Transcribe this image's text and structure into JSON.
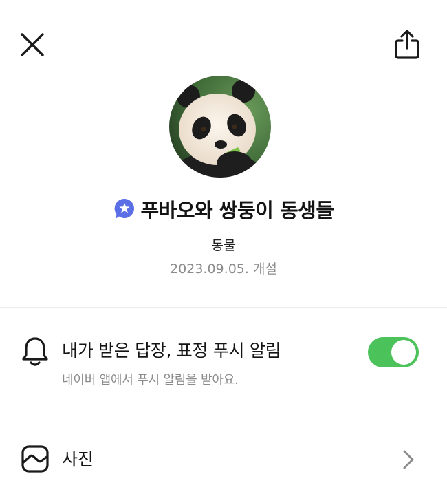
{
  "header": {
    "close_icon": "close-icon",
    "share_icon": "share-icon"
  },
  "profile": {
    "avatar_alt": "panda",
    "badge_icon": "star-chat-badge-icon",
    "title": "푸바오와 쌍둥이 동생들",
    "category": "동물",
    "created": "2023.09.05. 개설"
  },
  "notification": {
    "icon": "bell-icon",
    "title": "내가 받은 답장, 표정 푸시 알림",
    "subtitle": "네이버 앱에서 푸시 알림을 받아요.",
    "enabled": true,
    "toggle_color": "#4cc25a"
  },
  "menu": {
    "photos_label": "사진",
    "photos_icon": "photo-icon",
    "chevron_icon": "chevron-right-icon"
  },
  "colors": {
    "accent_badge": "#5a6ee6",
    "toggle_on": "#4cc25a",
    "muted_text": "#8b8b8b"
  }
}
